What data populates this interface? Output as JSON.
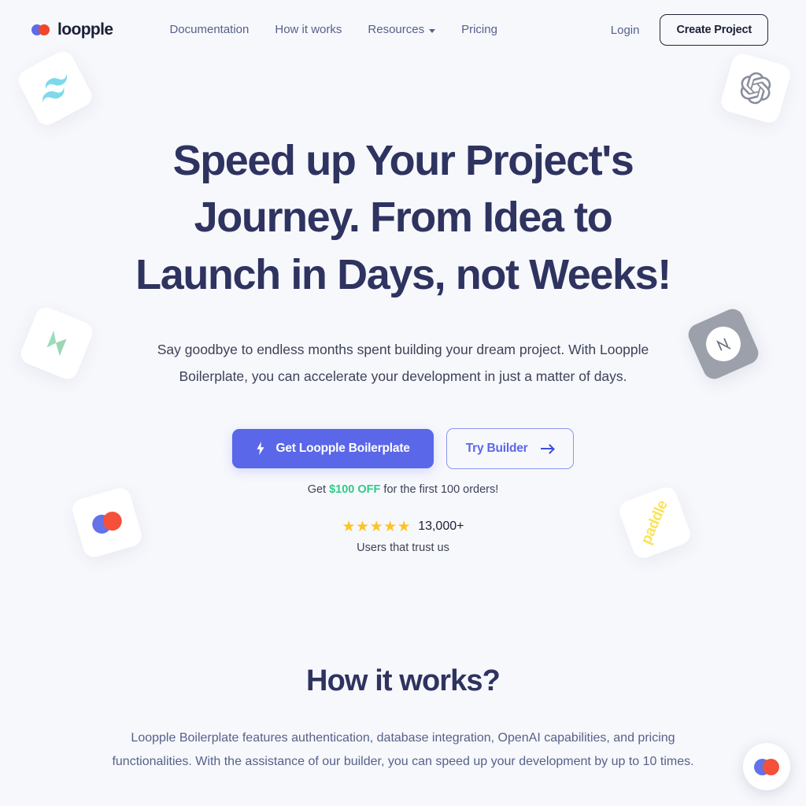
{
  "brand": {
    "name": "loopple",
    "logo_icon": "loopple-logo-icon",
    "colors": {
      "blue": "#5c6ce8",
      "red": "#f0472f"
    }
  },
  "nav": {
    "links": [
      {
        "label": "Documentation",
        "icon": null
      },
      {
        "label": "How it works",
        "icon": null
      },
      {
        "label": "Resources",
        "icon": "chevron-down-icon"
      },
      {
        "label": "Pricing",
        "icon": null
      }
    ],
    "login_label": "Login",
    "create_project_label": "Create Project"
  },
  "hero": {
    "heading": "Speed up Your Project's Journey. From Idea to Launch in Days, not Weeks!",
    "subheading": "Say goodbye to endless months spent building your dream project. With Loopple Boilerplate, you can accelerate your development in just a matter of days.",
    "primary_cta": {
      "label": "Get Loopple Boilerplate",
      "icon": "lightning-bolt-icon"
    },
    "secondary_cta": {
      "label": "Try Builder",
      "icon": "arrow-right-icon"
    },
    "offer": {
      "prefix": "Get ",
      "highlight": "$100 OFF",
      "suffix": " for the first 100 orders!",
      "highlight_color": "#2ecc87"
    },
    "rating": {
      "stars": "★★★★★",
      "star_color": "#fcc327",
      "count": "13,000+",
      "label": "Users that trust us"
    },
    "accent_color": "#5a67e8"
  },
  "floating_cards": [
    {
      "name": "tailwind-css-logo-icon",
      "label": ""
    },
    {
      "name": "openai-logo-icon",
      "label": ""
    },
    {
      "name": "supabase-logo-icon",
      "label": ""
    },
    {
      "name": "nextjs-logo-icon",
      "label": ""
    },
    {
      "name": "loopple-logo-icon",
      "label": ""
    },
    {
      "name": "paddle-logo-icon",
      "label": "paddle"
    }
  ],
  "how_it_works": {
    "heading": "How it works?",
    "body": "Loopple Boilerplate features authentication, database integration, OpenAI capabilities, and pricing functionalities. With the assistance of our builder, you can speed up your development by up to 10 times."
  },
  "chat_widget": {
    "icon": "loopple-chat-icon"
  }
}
